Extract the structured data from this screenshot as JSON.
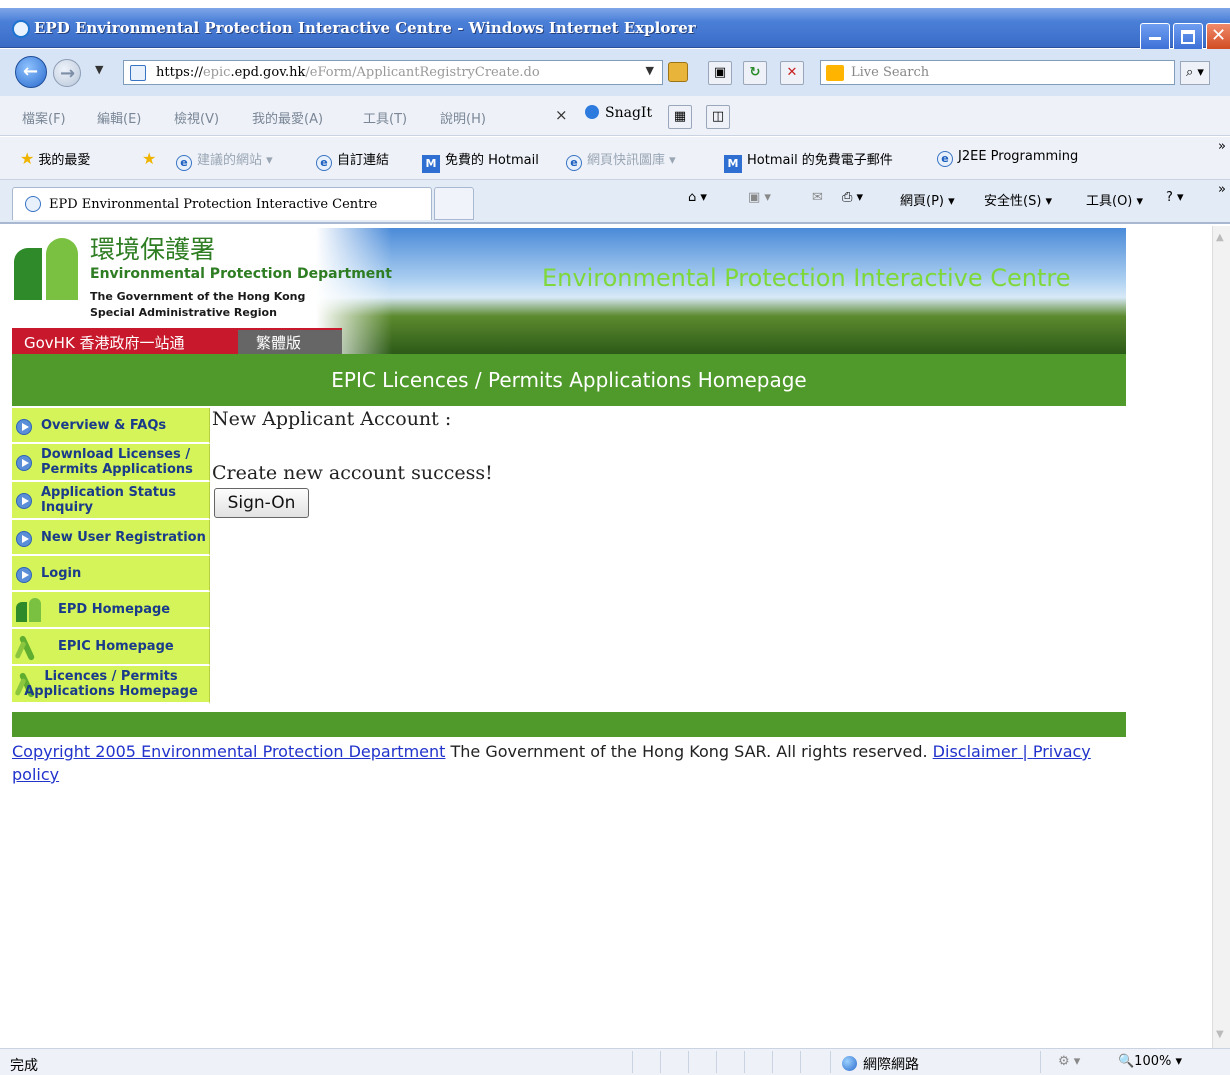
{
  "window": {
    "title": "EPD Environmental Protection Interactive Centre - Windows Internet Explorer"
  },
  "address_bar": {
    "url_scheme": "https://",
    "url_sub": "epic",
    "url_host": ".epd.gov.hk",
    "url_path": "/eForm/ApplicantRegistryCreate.do",
    "search_placeholder": "Live Search"
  },
  "menu_bar": {
    "items": [
      "檔案(F)",
      "編輯(E)",
      "檢視(V)",
      "我的最愛(A)",
      "工具(T)",
      "說明(H)"
    ],
    "close_x": "×",
    "snagit": "SnagIt"
  },
  "favorites_bar": {
    "favorites_label": "我的最愛",
    "items": [
      "建議的網站 ▾",
      "自訂連結",
      "免費的 Hotmail",
      "網頁快訊圖庫 ▾",
      "Hotmail 的免費電子郵件",
      "J2EE Programming"
    ],
    "overflow": "»"
  },
  "tabs": {
    "active_label": "EPD Environmental Protection Interactive Centre"
  },
  "command_bar": {
    "home": "⌂ ▾",
    "feeds": "▣ ▾",
    "mail": "✉",
    "print": "⎙ ▾",
    "page": "網頁(P) ▾",
    "safety": "安全性(S) ▾",
    "tools": "工具(O) ▾",
    "help": "? ▾",
    "overflow": "»"
  },
  "banner": {
    "org_zh": "環境保護署",
    "org_en": "Environmental Protection Department",
    "gov_line1": "The Government of the Hong Kong",
    "gov_line2": "Special Administrative Region",
    "govhk": "GovHK 香港政府一站通",
    "traditional": "繁體版",
    "site_title": "Environmental Protection Interactive Centre"
  },
  "page": {
    "section_title": "EPIC Licences / Permits Applications Homepage",
    "heading": "New Applicant Account :",
    "message": "Create new account success!",
    "signon_button": "Sign-On"
  },
  "side_menu": {
    "items": [
      {
        "label": "Overview & FAQs"
      },
      {
        "label_line1": "Download Licenses /",
        "label_line2": "Permits Applications"
      },
      {
        "label_line1": "Application Status",
        "label_line2": "Inquiry"
      },
      {
        "label": "New User Registration"
      },
      {
        "label": "Login"
      },
      {
        "label": "EPD Homepage"
      },
      {
        "label": "EPIC Homepage"
      },
      {
        "label_line1": "Licences / Permits",
        "label_line2": "Applications Homepage"
      }
    ]
  },
  "footer": {
    "copyright_link": "Copyright 2005 Environmental Protection Department",
    "rights_text": " The Government of the Hong Kong SAR. All rights reserved. ",
    "disclaimer": "Disclaimer",
    "separator": " | ",
    "privacy": "Privacy policy"
  },
  "status_bar": {
    "status": "完成",
    "zone": "網際網路",
    "protected": "⚙ ▾",
    "zoom": "🔍100% ▾"
  }
}
